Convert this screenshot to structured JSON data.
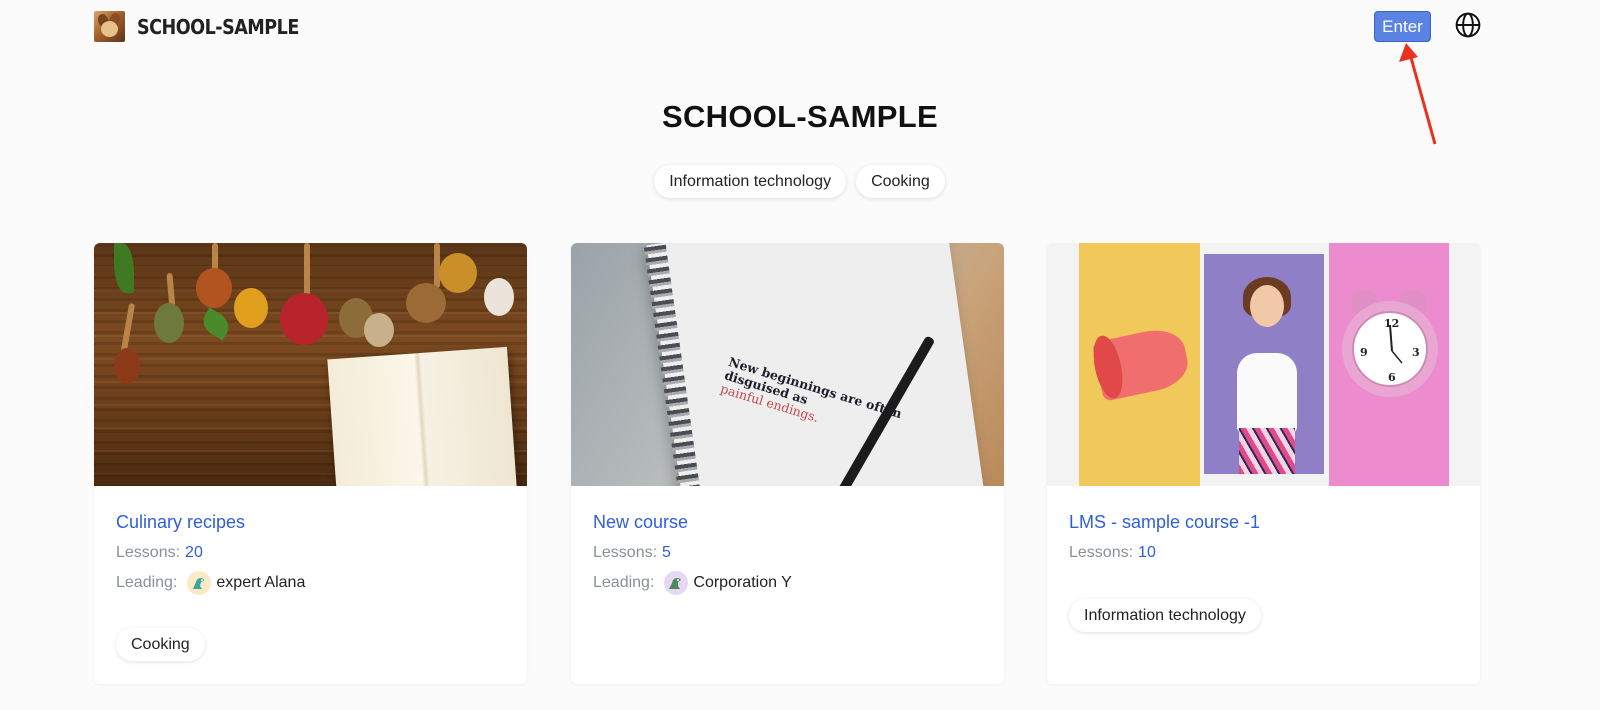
{
  "header": {
    "brand_name": "SCHOOL-SAMPLE",
    "enter_label": "Enter",
    "language_icon": "globe-icon"
  },
  "hero": {
    "title": "SCHOOL-SAMPLE",
    "tags": [
      "Information technology",
      "Cooking"
    ]
  },
  "labels": {
    "lessons": "Lessons:",
    "leading": "Leading:"
  },
  "courses": [
    {
      "title": "Culinary recipes",
      "lessons": "20",
      "leader": "expert Alana",
      "leader_avatar": "dinosaur-avatar",
      "tag": "Cooking",
      "image": "spices-and-notebook-image"
    },
    {
      "title": "New course",
      "lessons": "5",
      "leader": "Corporation Y",
      "leader_avatar": "dinosaur-avatar",
      "image": "notebook-quote-image",
      "image_text": {
        "line1": "New beginnings are often",
        "line2": "disguised as",
        "line3": "painful endings."
      }
    },
    {
      "title": "LMS - sample course -1",
      "lessons": "10",
      "tag": "Information technology",
      "image": "megaphone-woman-clock-collage"
    }
  ],
  "colors": {
    "accent": "#2e5fd9",
    "enter_button": "#5a83e4",
    "annotation_arrow": "#e8321e"
  }
}
